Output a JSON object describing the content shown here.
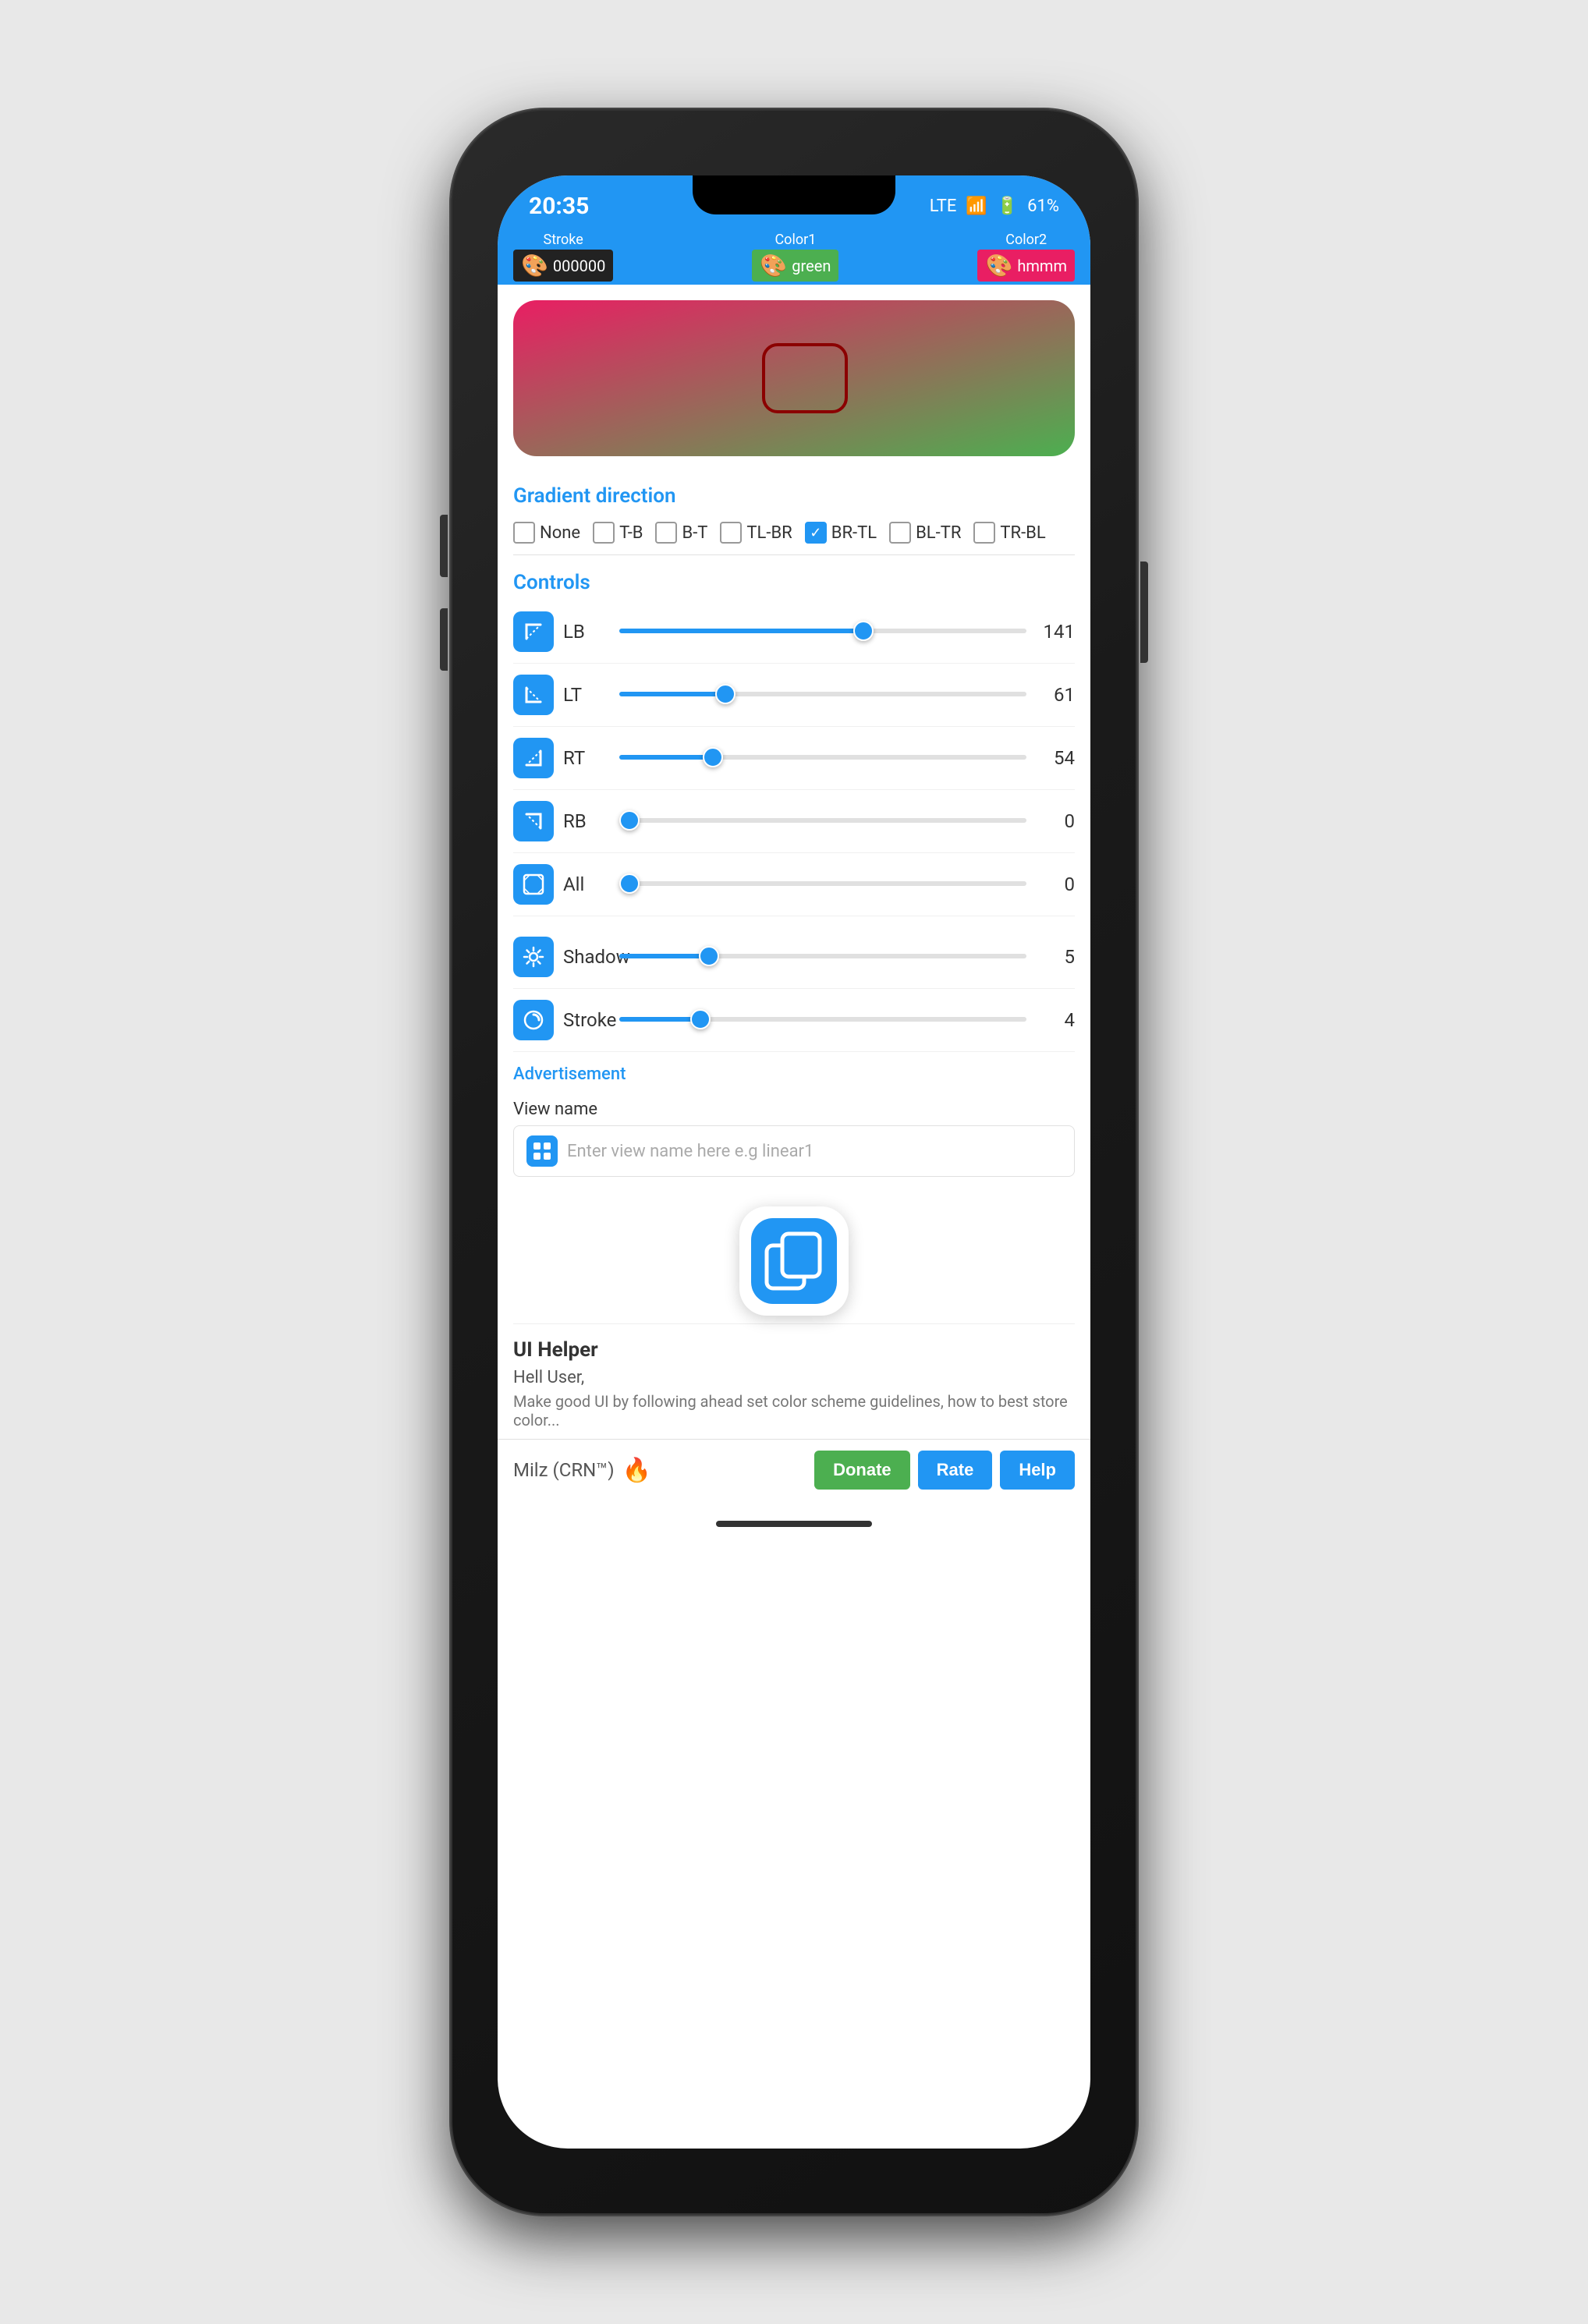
{
  "statusBar": {
    "time": "20:35",
    "network": "LTE",
    "battery": "61%",
    "icons": [
      "message-icon",
      "play-icon",
      "nfc-icon"
    ]
  },
  "header": {
    "strokeLabel": "Stroke",
    "strokeColor": "000000",
    "color1Label": "Color1",
    "color1Value": "green",
    "color2Label": "Color2",
    "color2Value": "hmmm"
  },
  "gradientSection": {
    "title": "Gradient direction",
    "options": [
      {
        "id": "none",
        "label": "None",
        "checked": false
      },
      {
        "id": "tb",
        "label": "T-B",
        "checked": false
      },
      {
        "id": "bt",
        "label": "B-T",
        "checked": false
      },
      {
        "id": "tlbr",
        "label": "TL-BR",
        "checked": false
      },
      {
        "id": "brtl",
        "label": "BR-TL",
        "checked": true
      },
      {
        "id": "bltr",
        "label": "BL-TR",
        "checked": false
      },
      {
        "id": "trbl",
        "label": "TR-BL",
        "checked": false
      }
    ]
  },
  "controls": {
    "title": "Controls",
    "sliders": [
      {
        "id": "lb",
        "label": "LB",
        "value": 141,
        "percent": 60,
        "icon": "arrow-lb"
      },
      {
        "id": "lt",
        "label": "LT",
        "value": 61,
        "percent": 26,
        "icon": "arrow-lt"
      },
      {
        "id": "rt",
        "label": "RT",
        "value": 54,
        "percent": 23,
        "icon": "arrow-rt"
      },
      {
        "id": "rb",
        "label": "RB",
        "value": 0,
        "percent": 0,
        "icon": "arrow-rb"
      },
      {
        "id": "all",
        "label": "All",
        "value": 0,
        "percent": 0,
        "icon": "expand-icon"
      }
    ],
    "shadowSlider": {
      "label": "Shadow",
      "value": 5,
      "percent": 22,
      "icon": "settings-icon"
    },
    "strokeSlider": {
      "label": "Stroke",
      "value": 4,
      "percent": 20,
      "icon": "stroke-icon"
    }
  },
  "advertisement": {
    "label": "Advertisement"
  },
  "viewName": {
    "label": "View name",
    "placeholder": "Enter view name here e.g linear1"
  },
  "appLogo": {
    "appName": "UI Helper"
  },
  "uiHelper": {
    "title": "UI Helper",
    "greeting": "Hell User,",
    "subtext": "Make good UI by following ahead set color scheme guidelines, how to best store color..."
  },
  "footer": {
    "branding": "Milz (CRN™)",
    "fireEmoji": "🔥",
    "buttons": {
      "donate": "Donate",
      "rate": "Rate",
      "help": "Help"
    }
  }
}
